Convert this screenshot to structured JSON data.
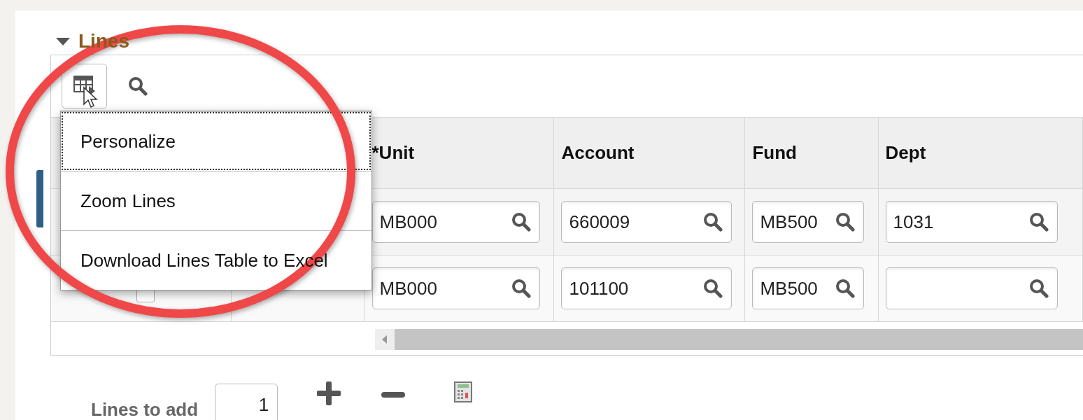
{
  "section": {
    "title": "Lines",
    "expanded": true
  },
  "menu": {
    "items": [
      {
        "label": "Personalize",
        "selected": true
      },
      {
        "label": "Zoom Lines",
        "selected": false
      },
      {
        "label": "Download Lines Table to Excel",
        "selected": false
      }
    ]
  },
  "table": {
    "columns": [
      "*Unit",
      "Account",
      "Fund",
      "Dept"
    ],
    "rows": [
      {
        "unit": "MB000",
        "account": "660009",
        "fund": "MB500",
        "dept": "1031"
      },
      {
        "checked": false,
        "unit": "MB000",
        "account": "101100",
        "fund": "MB500"
      }
    ]
  },
  "lines_to_add": {
    "label": "Lines to add",
    "value": "1"
  }
}
